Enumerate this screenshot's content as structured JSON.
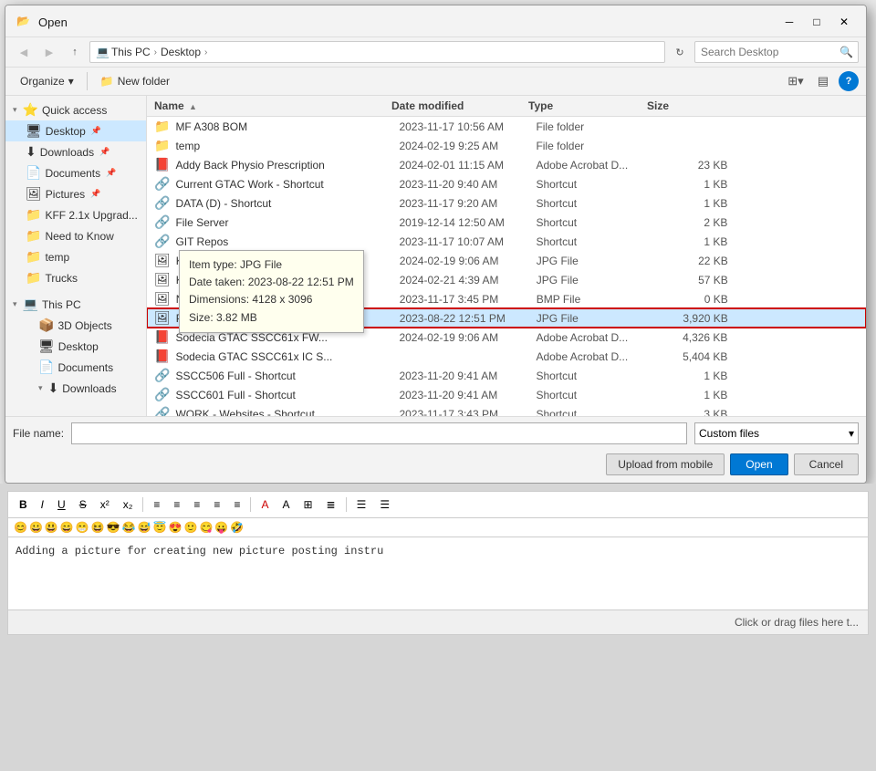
{
  "dialog": {
    "title": "Open",
    "addressPath": [
      "This PC",
      "Desktop"
    ],
    "searchPlaceholder": "Search Desktop",
    "toolbar": {
      "organize": "Organize",
      "organize_arrow": "▾",
      "new_folder": "New folder"
    },
    "columns": {
      "name": "Name",
      "date": "Date modified",
      "type": "Type",
      "size": "Size"
    },
    "files": [
      {
        "icon": "📁",
        "name": "MF A308 BOM",
        "date": "2023-11-17 10:56 AM",
        "type": "File folder",
        "size": ""
      },
      {
        "icon": "📁",
        "name": "temp",
        "date": "2024-02-19 9:25 AM",
        "type": "File folder",
        "size": ""
      },
      {
        "icon": "📄",
        "name": "Addy Back Physio Prescription",
        "date": "2024-02-01 11:15 AM",
        "type": "Adobe Acrobat D...",
        "size": "23 KB"
      },
      {
        "icon": "🔗",
        "name": "Current GTAC Work - Shortcut",
        "date": "2023-11-20 9:40 AM",
        "type": "Shortcut",
        "size": "1 KB"
      },
      {
        "icon": "🔗",
        "name": "DATA (D) - Shortcut",
        "date": "2023-11-17 9:20 AM",
        "type": "Shortcut",
        "size": "1 KB"
      },
      {
        "icon": "🔗",
        "name": "File Server",
        "date": "2019-12-14 12:50 AM",
        "type": "Shortcut",
        "size": "2 KB"
      },
      {
        "icon": "🔗",
        "name": "GIT Repos",
        "date": "2023-11-17 10:07 AM",
        "type": "Shortcut",
        "size": "1 KB"
      },
      {
        "icon": "🖼",
        "name": "KFF Join Reason mod error",
        "date": "2024-02-19 9:06 AM",
        "type": "JPG File",
        "size": "22 KB"
      },
      {
        "icon": "🖼",
        "name": "KFF_Pics_Step1",
        "date": "2024-02-21 4:39 AM",
        "type": "JPG File",
        "size": "57 KB"
      },
      {
        "icon": "🖼",
        "name": "New Bitmap Image",
        "date": "2023-11-17 3:45 PM",
        "type": "BMP File",
        "size": "0 KB"
      },
      {
        "icon": "🖼",
        "name": "Picture to post to KFF",
        "date": "2023-08-22 12:51 PM",
        "type": "JPG File",
        "size": "3,920 KB",
        "selected": true
      },
      {
        "icon": "📄",
        "name": "Sodecia GTAC SSCC61x FW...",
        "date": "2024-02-19 9:06 AM",
        "type": "Adobe Acrobat D...",
        "size": "4,326 KB"
      },
      {
        "icon": "📄",
        "name": "Sodecia GTAC SSCC61x IC S...",
        "date": "",
        "type": "Adobe Acrobat D...",
        "size": "5,404 KB"
      },
      {
        "icon": "🔗",
        "name": "SSCC506 Full - Shortcut",
        "date": "2023-11-20 9:41 AM",
        "type": "Shortcut",
        "size": "1 KB"
      },
      {
        "icon": "🔗",
        "name": "SSCC601 Full - Shortcut",
        "date": "2023-11-20 9:41 AM",
        "type": "Shortcut",
        "size": "1 KB"
      },
      {
        "icon": "🔗",
        "name": "WORK - Websites - Shortcut",
        "date": "2023-11-17 3:43 PM",
        "type": "Shortcut",
        "size": "3 KB"
      }
    ],
    "tooltip": {
      "item_type": "Item type: JPG File",
      "date_taken": "Date taken: 2023-08-22 12:51 PM",
      "dimensions": "Dimensions: 4128 x 3096",
      "size": "Size: 3.82 MB"
    },
    "filename_label": "File name:",
    "filename_value": "",
    "filetype_label": "Custom files",
    "buttons": {
      "upload": "Upload from mobile",
      "open": "Open",
      "cancel": "Cancel"
    }
  },
  "nav": {
    "quick_access": "Quick access",
    "items": [
      {
        "label": "Desktop",
        "icon": "🖥",
        "indent": 1,
        "pinned": true,
        "selected": true
      },
      {
        "label": "Downloads",
        "icon": "⬇",
        "indent": 1,
        "pinned": true
      },
      {
        "label": "Documents",
        "icon": "📄",
        "indent": 1,
        "pinned": true
      },
      {
        "label": "Pictures",
        "icon": "🖼",
        "indent": 1,
        "pinned": true
      },
      {
        "label": "KFF 2.1x Upgrad...",
        "icon": "📁",
        "indent": 1
      },
      {
        "label": "Need to Know",
        "icon": "📁",
        "indent": 1
      },
      {
        "label": "temp",
        "icon": "📁",
        "indent": 1
      },
      {
        "label": "Trucks",
        "icon": "📁",
        "indent": 1
      }
    ],
    "this_pc": "This PC",
    "this_pc_items": [
      {
        "label": "3D Objects",
        "icon": "📦",
        "indent": 2
      },
      {
        "label": "Desktop",
        "icon": "🖥",
        "indent": 2
      },
      {
        "label": "Documents",
        "icon": "📄",
        "indent": 2
      },
      {
        "label": "Downloads",
        "icon": "⬇",
        "indent": 2,
        "expanded": true
      }
    ]
  },
  "editor": {
    "toolbar_buttons": [
      "B",
      "I",
      "U",
      "S",
      "x²",
      "x₂"
    ],
    "align_buttons": [
      "≡",
      "≡",
      "≡",
      "≡",
      "≡"
    ],
    "emojis": [
      "😊",
      "😀",
      "😃",
      "😄",
      "😁",
      "😆",
      "😎",
      "😂",
      "😅",
      "😇",
      "😍",
      "🙂",
      "😋",
      "😛",
      "🤣"
    ],
    "content": "Adding a picture for creating new picture posting instru",
    "footer": "Click or drag files here t..."
  }
}
